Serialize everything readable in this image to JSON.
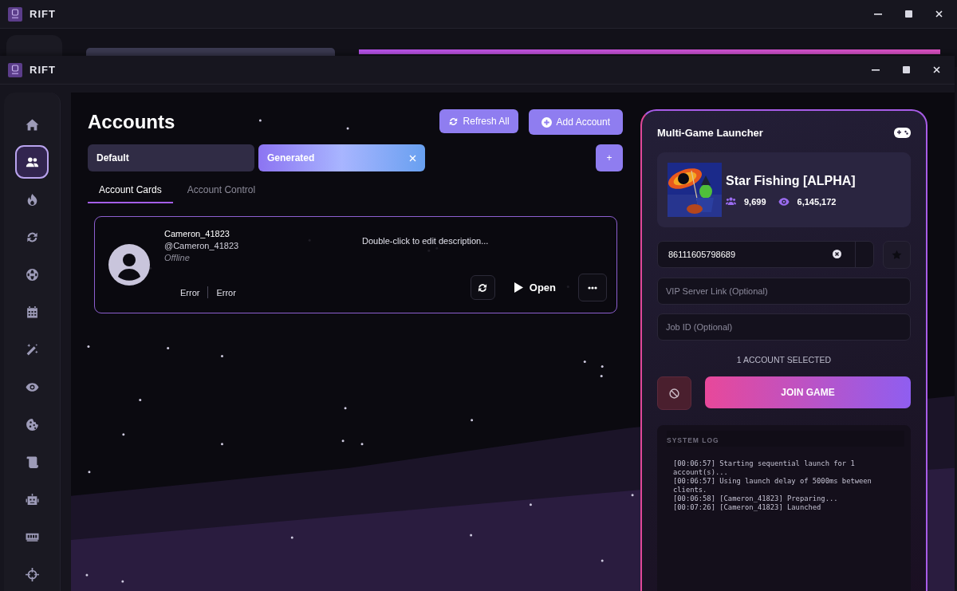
{
  "background_window": {
    "title": "RIFT"
  },
  "window": {
    "title": "RIFT"
  },
  "sidebar": {
    "items": [
      {
        "kind": "home",
        "selected": false
      },
      {
        "kind": "users",
        "selected": true
      },
      {
        "kind": "fire",
        "selected": false
      },
      {
        "kind": "sync",
        "selected": false
      },
      {
        "kind": "globe",
        "selected": false
      },
      {
        "kind": "calendar",
        "selected": false
      },
      {
        "kind": "wand",
        "selected": false
      },
      {
        "kind": "eye",
        "selected": false
      },
      {
        "kind": "cookie",
        "selected": false
      },
      {
        "kind": "scroll",
        "selected": false
      },
      {
        "kind": "robot",
        "selected": false
      },
      {
        "kind": "memory",
        "selected": false
      },
      {
        "kind": "crosshairs",
        "selected": false
      }
    ]
  },
  "page": {
    "title": "Accounts",
    "buttons": [
      {
        "kind": "refresh",
        "label": "Refresh All"
      },
      {
        "kind": "add",
        "label": "Add Account"
      }
    ]
  },
  "groups": [
    {
      "label": "Default",
      "selected": false,
      "closable": false
    },
    {
      "label": "Generated",
      "selected": true,
      "closable": true
    }
  ],
  "add_group_button": "+",
  "view_tabs": [
    {
      "label": "Account Cards",
      "selected": true
    },
    {
      "label": "Account Control",
      "selected": false
    }
  ],
  "accounts": [
    {
      "name": "Cameron_41823",
      "handle": "@Cameron_41823",
      "status": "Offline",
      "description": "Double-click to edit description...",
      "fields": [
        "Error",
        "Error"
      ],
      "open_label": "Open"
    }
  ],
  "launcher": {
    "title": "Multi-Game Launcher",
    "game": {
      "name": "Star Fishing [ALPHA]",
      "players": "9,699",
      "visits": "6,145,172"
    },
    "place_id": "86111605798689",
    "vip_placeholder": "VIP Server Link (Optional)",
    "job_placeholder": "Job ID (Optional)",
    "selection": "1 ACCOUNT SELECTED",
    "join_label": "JOIN GAME",
    "log_title": "SYSTEM LOG",
    "log": [
      "[00:06:57] Starting sequential launch for 1 account(s)...",
      "[00:06:57] Using launch delay of 5000ms between clients.",
      "[00:06:58] [Cameron_41823] Preparing...",
      "[00:07:26] [Cameron_41823] Launched"
    ]
  }
}
